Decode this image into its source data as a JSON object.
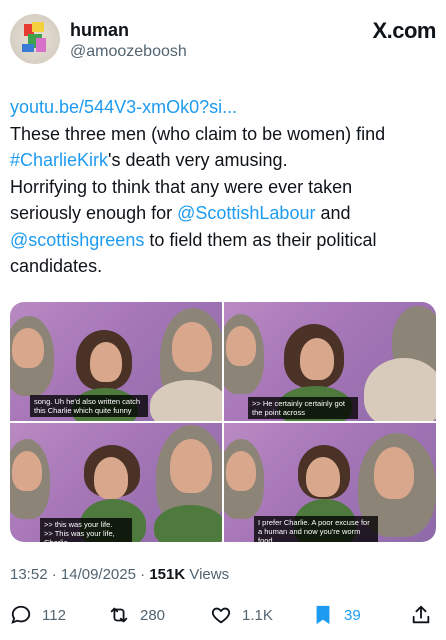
{
  "header": {
    "display_name": "human",
    "handle": "@amoozeboosh",
    "brand": "X.com"
  },
  "tweet": {
    "line1_link": "youtu.be/544V3-xmOk0?si...",
    "line2": "These three men (who claim to be women) find",
    "line3_hashtag": "#CharlieKirk",
    "line3_rest": "'s death very amusing.",
    "line4": "Horrifying to think that any were ever taken",
    "line5_start": "seriously enough for ",
    "line5_mention": "@ScottishLabour",
    "line5_end": " and",
    "line6_mention": "@scottishgreens",
    "line6_rest": " to field them as their political",
    "line7": "candidates."
  },
  "media": {
    "captions": [
      "song. Uh he'd also written catch this Charlie which quite funny",
      ">> He certainly certainly got the point across",
      ">> this was your life.\n>> This was your life, Charlie.",
      "I prefer Charlie. A poor excuse for a human and now you're worm food."
    ]
  },
  "meta": {
    "time": "13:52",
    "date": "14/09/2025",
    "views_count": "151K",
    "views_label": "Views"
  },
  "actions": {
    "replies": "112",
    "reposts": "280",
    "likes": "1.1K",
    "bookmarks": "39"
  },
  "colors": {
    "link": "#1d9bf0",
    "secondary_text": "#536471",
    "primary_text": "#0f1419"
  },
  "icons": [
    "reply-icon",
    "repost-icon",
    "like-icon",
    "bookmark-icon",
    "share-icon"
  ]
}
